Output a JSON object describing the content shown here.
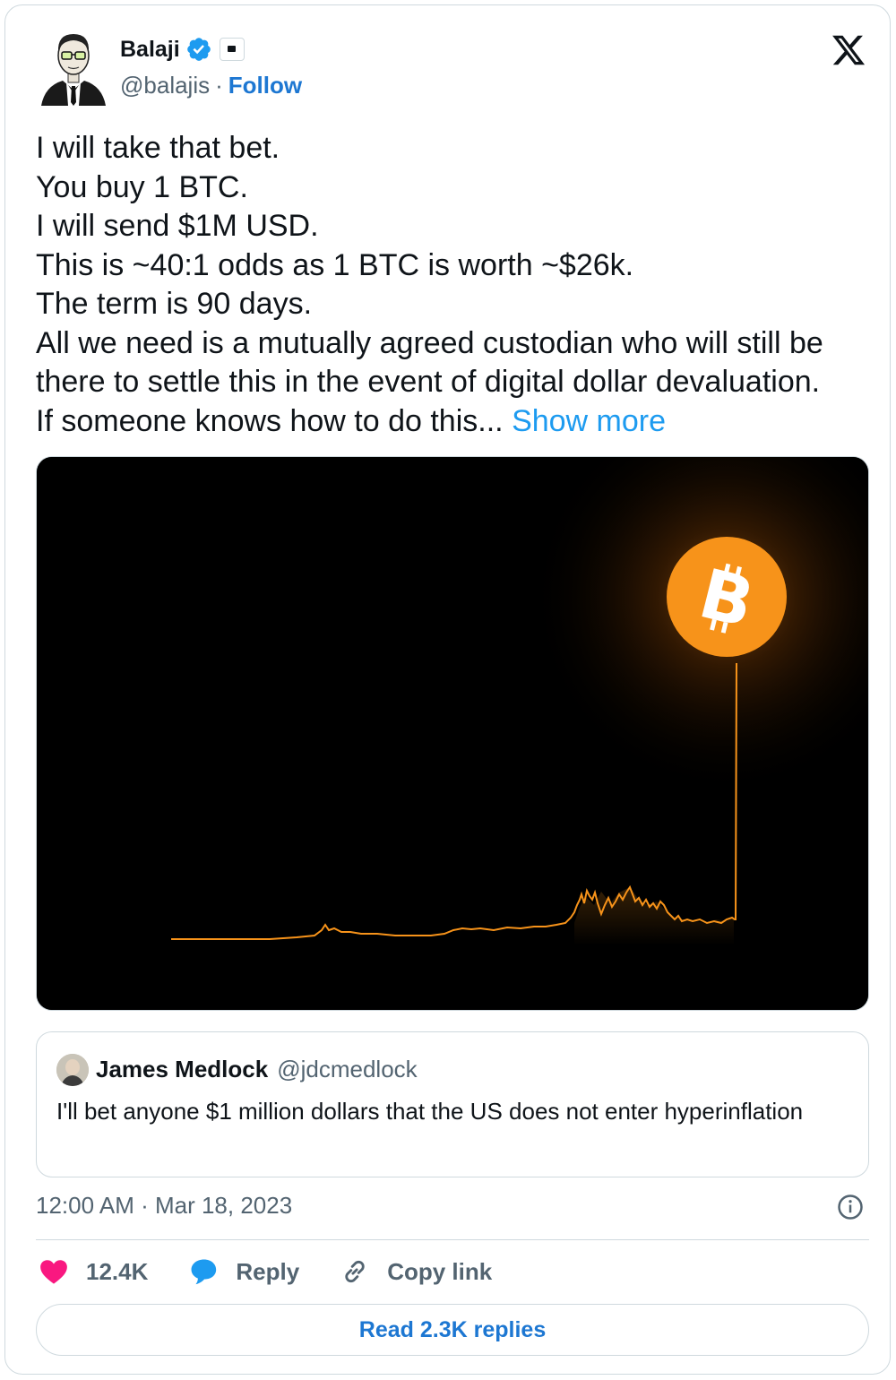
{
  "author": {
    "display_name": "Balaji",
    "handle": "@balajis",
    "separator": "·",
    "follow_label": "Follow",
    "verified": true
  },
  "tweet": {
    "lines": [
      "I will take that bet.",
      "You buy 1 BTC.",
      "I will send $1M USD.",
      "This is ~40:1 odds as 1 BTC is worth ~$26k.",
      "The term is 90 days.",
      "All we need is a mutually agreed custodian who will still be",
      "there to settle this in the event of digital dollar devaluation."
    ],
    "last_line": "If someone knows how to do this... ",
    "show_more": "Show more",
    "media_icon": "bitcoin-logo-icon",
    "accent_color": "#f7931a"
  },
  "quote": {
    "display_name": "James Medlock",
    "handle": "@jdcmedlock",
    "text": "I'll bet anyone $1 million dollars that the US does not enter hyperinflation"
  },
  "footer": {
    "timestamp": "12:00 AM · Mar 18, 2023",
    "likes": "12.4K",
    "reply_label": "Reply",
    "copy_link_label": "Copy link",
    "read_replies": "Read 2.3K replies"
  },
  "colors": {
    "link": "#1d9bf0",
    "follow": "#1d77d2",
    "like": "#f91880",
    "reply_icon": "#1d9bf0",
    "muted": "#536471"
  }
}
